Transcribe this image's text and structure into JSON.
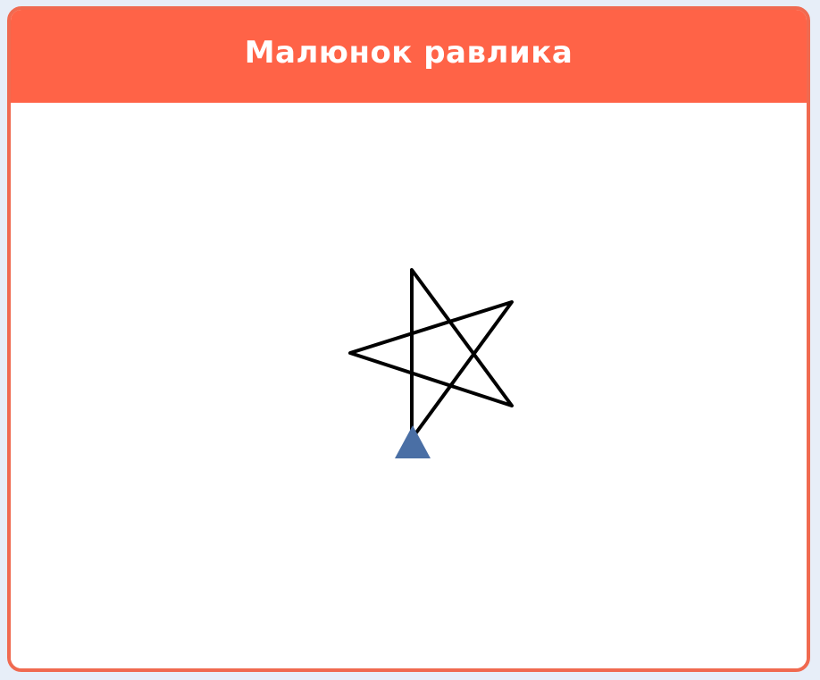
{
  "panel": {
    "title": "Малюнок равлика"
  },
  "colors": {
    "header_background": "#ff6347",
    "panel_border": "#f06a50",
    "page_background": "#e7eef8",
    "canvas_background": "#ffffff",
    "trail_stroke": "#000000",
    "turtle_fill": "#4a6fa5"
  },
  "turtle": {
    "icon": "turtle-cursor-icon",
    "shape": "triangle",
    "heading": "up"
  }
}
